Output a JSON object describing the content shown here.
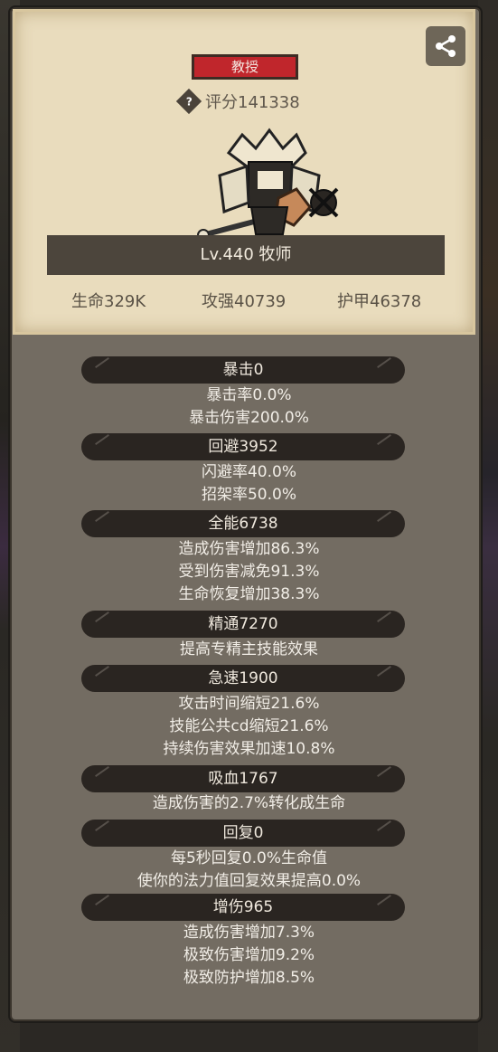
{
  "profile": {
    "title_badge": "教授",
    "score": "评分141338",
    "level_class": "Lv.440 牧师",
    "hp": "生命329K",
    "attack": "攻强40739",
    "armor": "护甲46378"
  },
  "sections": [
    {
      "header": "暴击0",
      "lines": [
        "暴击率0.0%",
        "暴击伤害200.0%"
      ]
    },
    {
      "header": "回避3952",
      "lines": [
        "闪避率40.0%",
        "招架率50.0%"
      ]
    },
    {
      "header": "全能6738",
      "lines": [
        "造成伤害增加86.3%",
        "受到伤害减免91.3%",
        "生命恢复增加38.3%"
      ]
    },
    {
      "header": "精通7270",
      "lines": [
        "提高专精主技能效果"
      ]
    },
    {
      "header": "急速1900",
      "lines": [
        "攻击时间缩短21.6%",
        "技能公共cd缩短21.6%",
        "持续伤害效果加速10.8%"
      ]
    },
    {
      "header": "吸血1767",
      "lines": [
        "造成伤害的2.7%转化成生命"
      ]
    },
    {
      "header": "回复0",
      "lines": [
        "每5秒回复0.0%生命值",
        "使你的法力值回复效果提高0.0%"
      ]
    },
    {
      "header": "增伤965",
      "lines": [
        "造成伤害增加7.3%",
        "极致伤害增加9.2%",
        "极致防护增加8.5%"
      ]
    }
  ]
}
